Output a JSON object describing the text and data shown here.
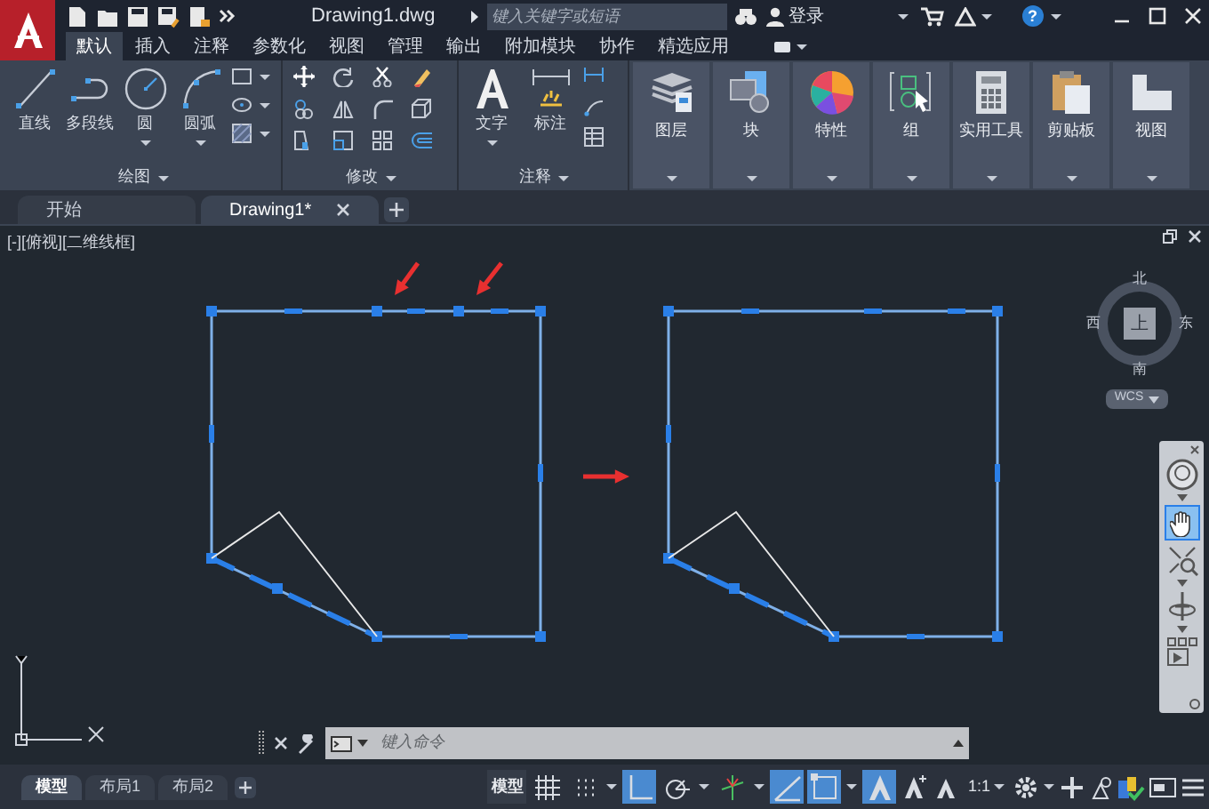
{
  "title_bar": {
    "file_name": "Drawing1.dwg",
    "search": {
      "placeholder": "键入关键字或短语"
    },
    "sign_in": "登录",
    "help": "?"
  },
  "ribbon_tabs": [
    {
      "label": "默认",
      "selected": true
    },
    {
      "label": "插入",
      "selected": false
    },
    {
      "label": "注释",
      "selected": false
    },
    {
      "label": "参数化",
      "selected": false
    },
    {
      "label": "视图",
      "selected": false
    },
    {
      "label": "管理",
      "selected": false
    },
    {
      "label": "输出",
      "selected": false
    },
    {
      "label": "附加模块",
      "selected": false
    },
    {
      "label": "协作",
      "selected": false
    },
    {
      "label": "精选应用",
      "selected": false
    }
  ],
  "draw_panel": {
    "title": "绘图",
    "tools": [
      {
        "label": "直线",
        "dropdown": false
      },
      {
        "label": "多段线",
        "dropdown": false
      },
      {
        "label": "圆",
        "dropdown": true
      },
      {
        "label": "圆弧",
        "dropdown": true
      }
    ]
  },
  "modify_panel": {
    "title": "修改"
  },
  "annotation_panel": {
    "title": "注释",
    "tools": [
      {
        "label": "文字",
        "dropdown": true
      },
      {
        "label": "标注",
        "dropdown": false
      }
    ]
  },
  "large_panels": [
    {
      "label": "图层"
    },
    {
      "label": "块"
    },
    {
      "label": "特性"
    },
    {
      "label": "组"
    },
    {
      "label": "实用工具"
    },
    {
      "label": "剪贴板"
    },
    {
      "label": "视图"
    }
  ],
  "document_tabs": [
    {
      "label": "开始",
      "selected": false
    },
    {
      "label": "Drawing1*",
      "selected": true
    }
  ],
  "viewport": {
    "label": "[-][俯视][二维线框]",
    "viewcube": {
      "top": "上",
      "north": "北",
      "south": "南",
      "east": "东",
      "west": "西",
      "wcs": "WCS"
    }
  },
  "command_line": {
    "placeholder": "键入命令"
  },
  "layout_tabs": [
    {
      "label": "模型",
      "selected": true
    },
    {
      "label": "布局1",
      "selected": false
    },
    {
      "label": "布局2",
      "selected": false
    }
  ],
  "status_bar": {
    "model": "模型",
    "scale": "1:1",
    "toggles": [
      {
        "on": false
      },
      {
        "on": false
      },
      {
        "on": true
      },
      {
        "on": false
      },
      {
        "on": false
      },
      {
        "on": true
      },
      {
        "on": true
      },
      {
        "on": true
      }
    ]
  }
}
